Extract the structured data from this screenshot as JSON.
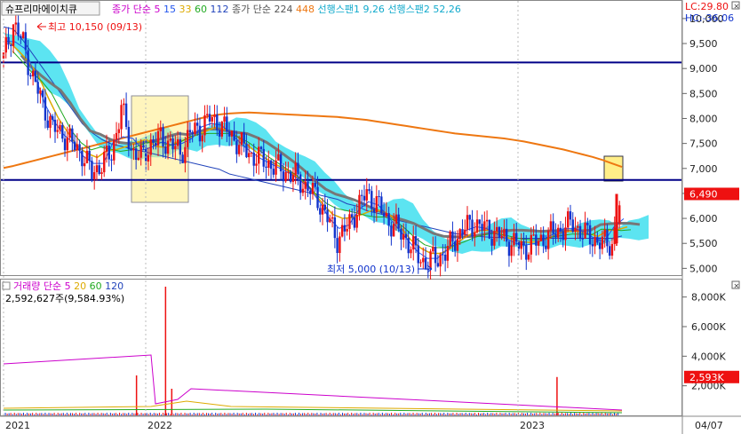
{
  "header": {
    "stock_name": "슈프리마에이치큐",
    "ma_label": "종가 단순",
    "ma_periods": [
      "5",
      "15",
      "33",
      "60",
      "112"
    ],
    "ma_colors": [
      "#cc00cc",
      "#2255ee",
      "#ddaa00",
      "#22aa22",
      "#2244bb"
    ],
    "ma_label2": "종가 단순",
    "ma_periods2": [
      "224",
      "448"
    ],
    "ma_colors2": [
      "#555555",
      "#ee7711"
    ],
    "span1": "선행스팬1 9,26",
    "span2": "선행스팬2 52,26",
    "lc": "LC:29.80",
    "hc": "HC:-36.06"
  },
  "volume_header": {
    "label": "거래량",
    "ma_label": "단순",
    "periods": [
      "5",
      "20",
      "60",
      "120"
    ],
    "period_colors": [
      "#cc00cc",
      "#ddaa00",
      "#22aa22",
      "#2244bb"
    ],
    "value": "2,592,627주(9,584.93%)"
  },
  "annotations": {
    "high": "최고 10,150 (09/13)",
    "low": "최저 5,000 (10/13)"
  },
  "colors": {
    "up": "#ee1111",
    "down": "#1133cc",
    "cloud": "#33ddee",
    "hline": "#000088",
    "price_tag": "#ee1111",
    "highlight": "#ffee88"
  },
  "chart_data": [
    {
      "type": "candlestick",
      "name": "price",
      "x_tick_labels": [
        "2021",
        "2022",
        "2023",
        "04/07"
      ],
      "y_tick_labels": [
        "10,000",
        "9,500",
        "9,000",
        "8,500",
        "8,000",
        "7,500",
        "7,000",
        "6,500",
        "6,000",
        "5,500",
        "5,000"
      ],
      "ylim": [
        4900,
        10300
      ],
      "last_price": 6490,
      "last_price_label": "6,490",
      "high": 10150,
      "low": 5000,
      "horizontal_levels": [
        9120,
        6770
      ],
      "close_approx": [
        9200,
        9900,
        9500,
        8800,
        8300,
        7800,
        7700,
        7500,
        7300,
        6900,
        7100,
        7300,
        8200,
        7400,
        7200,
        7500,
        7600,
        7500,
        7300,
        7700,
        7800,
        8000,
        7900,
        7700,
        7500,
        7300,
        7200,
        7100,
        7000,
        6900,
        6800,
        6600,
        6400,
        6000,
        5600,
        5800,
        6200,
        6500,
        6300,
        6000,
        5800,
        5600,
        5300,
        5100,
        5200,
        5300,
        5600,
        5800,
        5900,
        5800,
        5700,
        5600,
        5500,
        5400,
        5500,
        5600,
        5700,
        5800,
        5900,
        5700,
        5600,
        5500,
        5500,
        6490
      ],
      "ma224_approx": [
        10200,
        10150,
        9900,
        9600,
        9300,
        9000,
        8700,
        8400,
        8100,
        7900,
        7750,
        7650,
        7600,
        7550,
        7500,
        7450,
        7400,
        7350,
        7300,
        7250,
        7200,
        7150,
        7100,
        7000,
        6950,
        6900,
        6850,
        6800,
        6750,
        6700,
        6650,
        6600,
        6550,
        6500,
        6450,
        6350,
        6300,
        6200,
        6150,
        6100,
        6000,
        5950,
        5900,
        5850,
        5800,
        5750,
        5700,
        5680,
        5650,
        5630,
        5620,
        5610,
        5600,
        5600,
        5600,
        5600,
        5600,
        5600,
        5600,
        5600,
        5600,
        5600,
        5600,
        5650
      ],
      "ma448_approx": [
        7010,
        7050,
        7100,
        7150,
        7200,
        7250,
        7300,
        7350,
        7400,
        7450,
        7500,
        7550,
        7600,
        7650,
        7700,
        7750,
        7800,
        7850,
        7900,
        7950,
        8000,
        8050,
        8080,
        8100,
        8110,
        8120,
        8110,
        8100,
        8090,
        8080,
        8070,
        8060,
        8050,
        8040,
        8030,
        8010,
        7990,
        7970,
        7940,
        7910,
        7880,
        7850,
        7820,
        7790,
        7760,
        7730,
        7700,
        7680,
        7660,
        7640,
        7620,
        7600,
        7570,
        7540,
        7500,
        7460,
        7420,
        7380,
        7330,
        7280,
        7230,
        7170,
        7100,
        7030
      ]
    },
    {
      "type": "bar",
      "name": "volume",
      "y_tick_labels": [
        "8,000K",
        "6,000K",
        "4,000K",
        "2,000K"
      ],
      "ylim": [
        0,
        9000
      ],
      "last_volume_label": "2,593K",
      "spikes": [
        {
          "position": 0.215,
          "value": 2700
        },
        {
          "position": 0.262,
          "value": 8700
        },
        {
          "position": 0.272,
          "value": 1800
        },
        {
          "position": 0.895,
          "value": 2593
        }
      ]
    }
  ]
}
